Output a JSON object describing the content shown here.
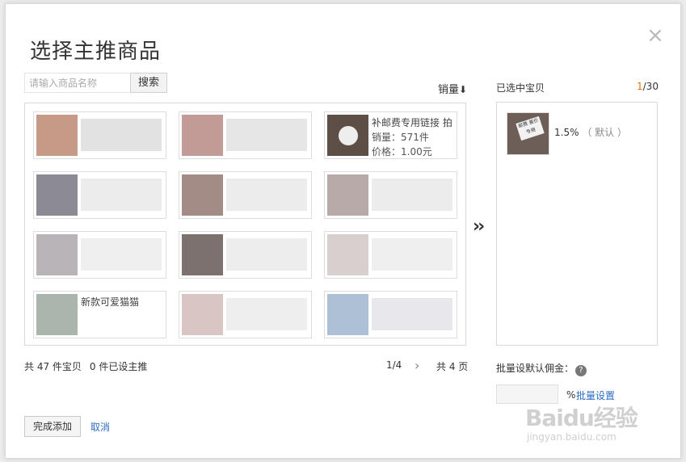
{
  "dialog": {
    "title": "选择主推商品",
    "close_icon": "close-icon"
  },
  "search": {
    "placeholder": "请输入商品名称",
    "button": "搜索"
  },
  "sort": {
    "label": "销量",
    "arrow": "⬇"
  },
  "products": [
    {
      "title": "",
      "sales": "",
      "price": ""
    },
    {
      "title": "",
      "sales": "",
      "price": ""
    },
    {
      "title": "补邮费专用链接 拍",
      "sales_label": "销量：",
      "sales": "571件",
      "price_label": "价格：",
      "price": "1.00元"
    },
    {
      "title": "",
      "sales": "",
      "price": ""
    },
    {
      "title": "",
      "sales": "",
      "price": ""
    },
    {
      "title": "",
      "sales": "",
      "price": ""
    },
    {
      "title": "",
      "sales": "",
      "price": ""
    },
    {
      "title": "",
      "sales": "",
      "price": ""
    },
    {
      "title": "",
      "sales": "",
      "price": ""
    },
    {
      "title": "新款可爱猫猫",
      "sales": "",
      "price": ""
    },
    {
      "title": "",
      "sales": "",
      "price": ""
    },
    {
      "title": "",
      "sales": "",
      "price": ""
    }
  ],
  "footer": {
    "total": "共 47 件宝贝",
    "featured": "0 件已设主推",
    "page": "1/4",
    "next_icon": "chevron-right-icon",
    "pages_total": "共 4 页"
  },
  "selected": {
    "header": "已选中宝贝",
    "count_current": "1",
    "count_max": "/30",
    "items": [
      {
        "rate": "1.5%",
        "default": "（ 默认 ）",
        "tag": "邮费 差价 专用"
      }
    ]
  },
  "batch": {
    "label": "批量设默认佣金：",
    "help_icon": "?",
    "percent": "%",
    "button": "批量设置"
  },
  "actions": {
    "done": "完成添加",
    "cancel": "取消"
  },
  "transfer_icon": "››",
  "watermark": {
    "brand": "Baidu经验",
    "url": "jingyan.baidu.com"
  },
  "colors": {
    "accent": "#2b6cc4",
    "count_highlight": "#e66f00"
  }
}
